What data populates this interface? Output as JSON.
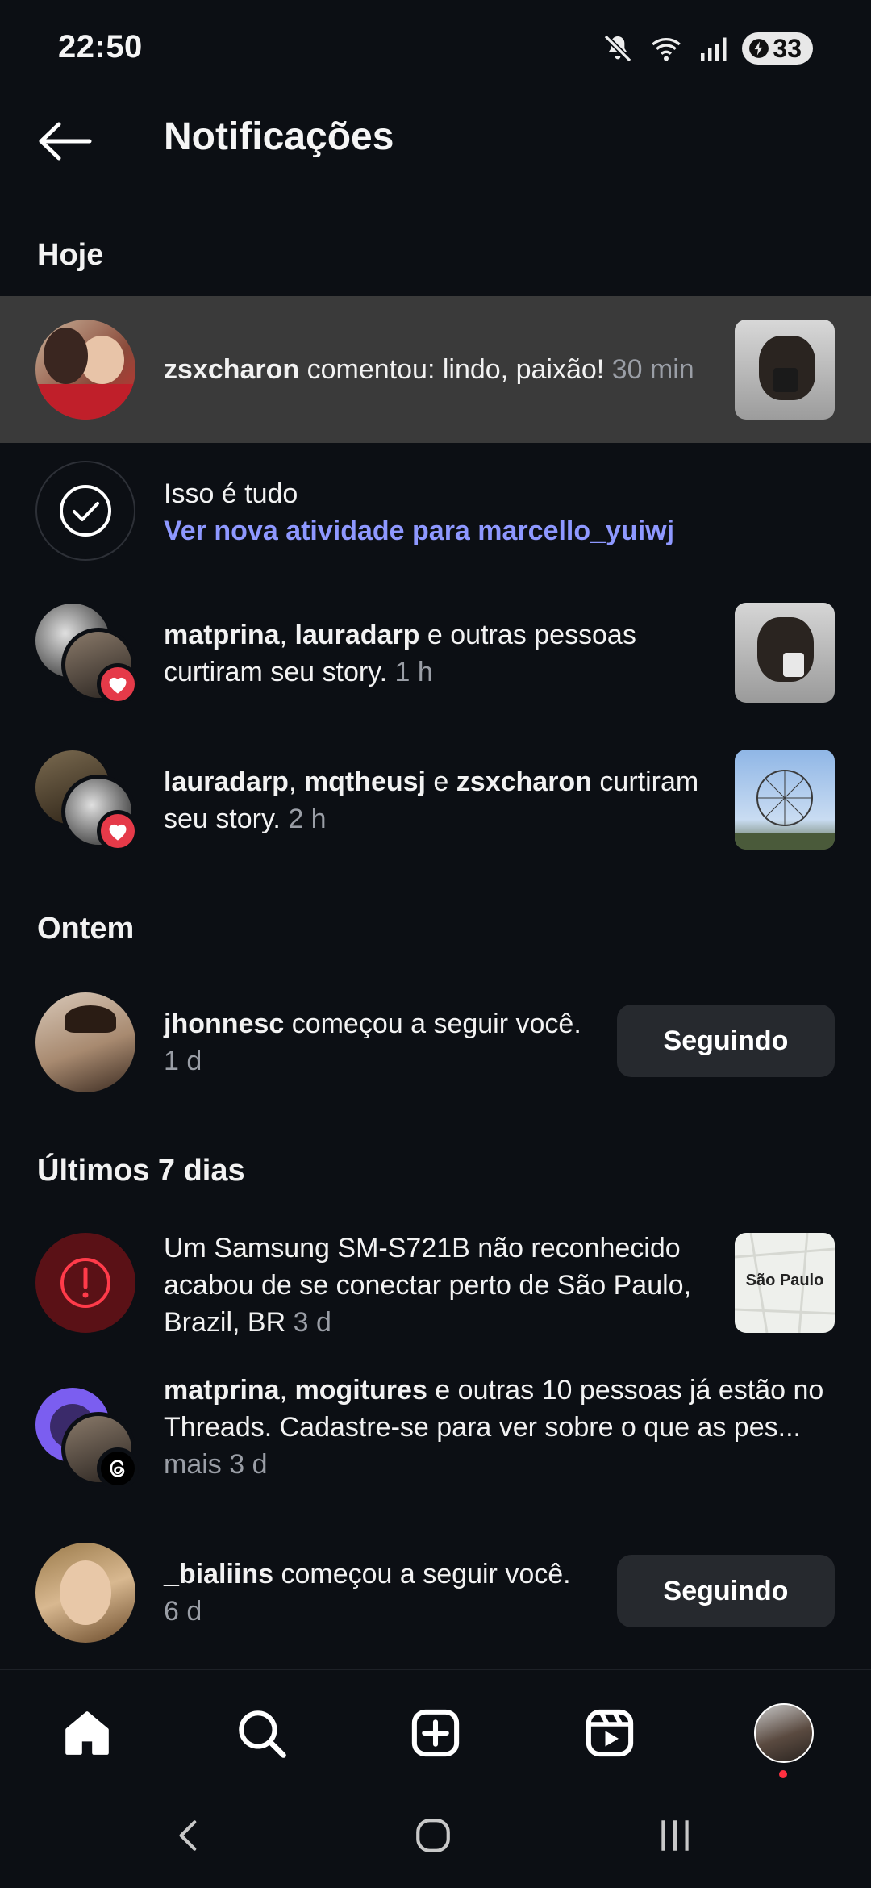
{
  "status_bar": {
    "time": "22:50",
    "battery": "33",
    "icons": [
      "mute-icon",
      "wifi-icon",
      "signal-icon",
      "battery-icon"
    ]
  },
  "header": {
    "title": "Notificações"
  },
  "sections": {
    "today": "Hoje",
    "yesterday": "Ontem",
    "last7": "Últimos 7 dias"
  },
  "notifications": {
    "n1": {
      "user": "zsxcharon",
      "text": " comentou: lindo, paixão!",
      "time": " 30 min"
    },
    "n2": {
      "title": "Isso é tudo",
      "link": "Ver nova atividade para marcello_yuiwj"
    },
    "n3": {
      "user1": "matprina",
      "sep": ", ",
      "user2": "lauradarp",
      "text_a": " e outras pessoas",
      "text_b": "curtiram seu story.",
      "time": " 1 h"
    },
    "n4": {
      "user1": "lauradarp",
      "sep1": ", ",
      "user2": "mqtheusj",
      "sep2": " e ",
      "user3": "zsxcharon",
      "text_a": " curtiram",
      "text_b": "seu story.",
      "time": " 2 h"
    },
    "n5": {
      "user": "jhonnesc",
      "text": " começou a seguir você.",
      "time": "1 d",
      "button": "Seguindo"
    },
    "n6": {
      "line1": "Um Samsung SM-S721B não reconhecido",
      "line2": "acabou de se conectar perto de São Paulo,",
      "line3": "Brazil, BR",
      "time": " 3 d",
      "map_label": "São Paulo"
    },
    "n7": {
      "user1": "matprina",
      "sep": ", ",
      "user2": "mogitures",
      "text_a": " e outras 10 pessoas já estão no",
      "text_b": "Threads. Cadastre-se para ver sobre o que as pes...",
      "text_c": "mais",
      "time": " 3 d"
    },
    "n8": {
      "user": "_bialiins",
      "text": " começou a seguir você.",
      "time": "6 d",
      "button": "Seguindo"
    }
  },
  "colors": {
    "background": "#0c0f14",
    "highlight_row": "#3a3a3a",
    "link": "#8e98ff",
    "heart": "#e53a49",
    "button_bg": "#26292e",
    "alert": "#e53a49"
  },
  "bottom_nav": [
    "home-icon",
    "search-icon",
    "create-icon",
    "reels-icon",
    "profile-avatar"
  ]
}
